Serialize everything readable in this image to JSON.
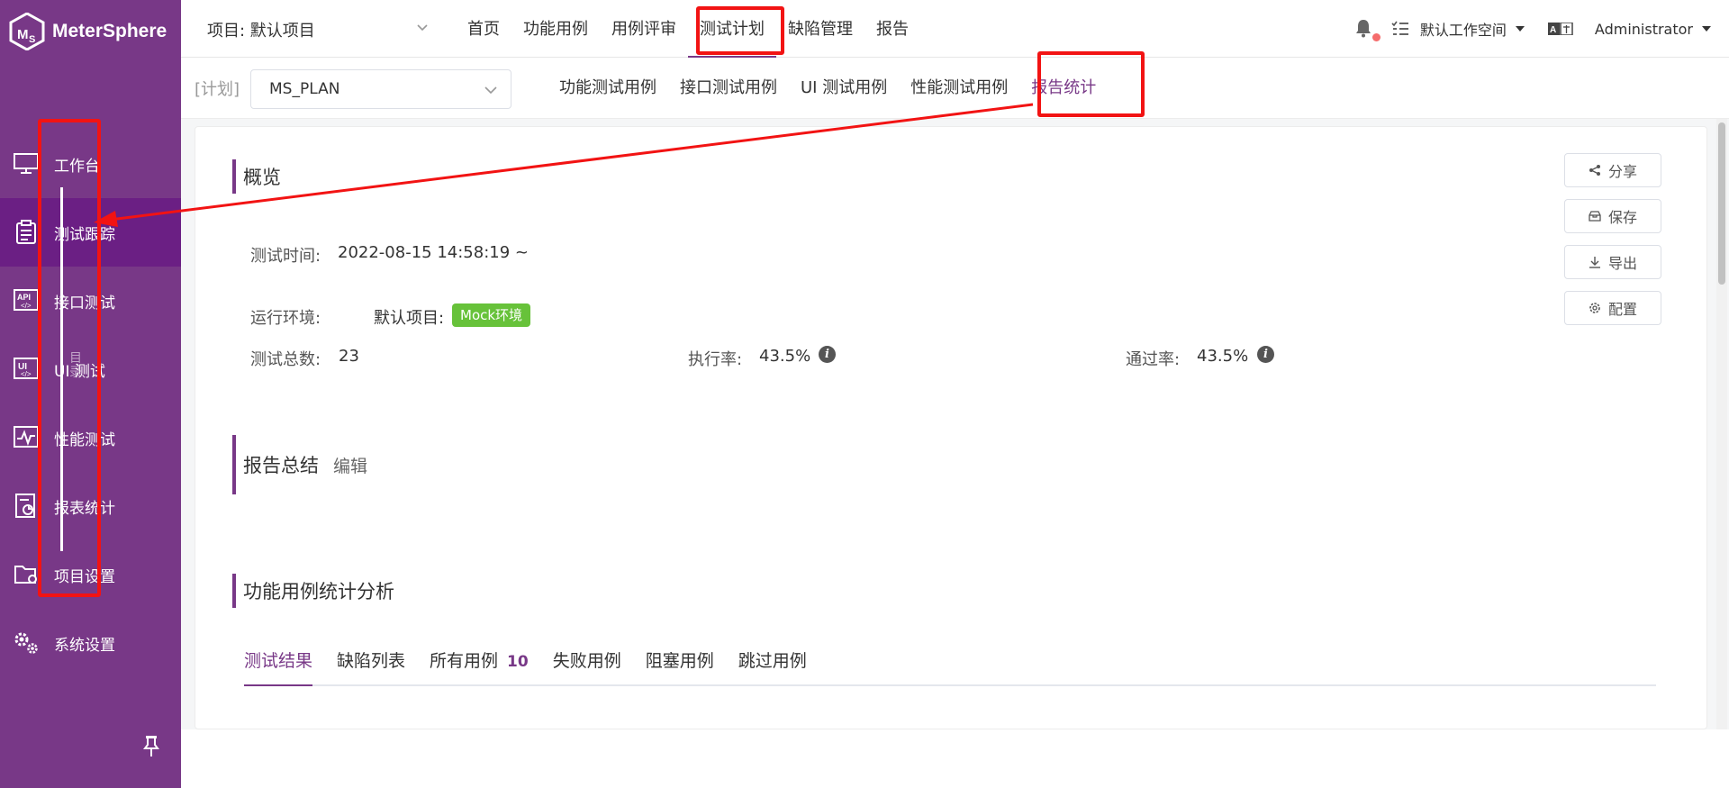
{
  "app": {
    "name": "MeterSphere"
  },
  "sidebar": {
    "items": [
      {
        "label": "工作台",
        "icon": "monitor-icon",
        "active": false
      },
      {
        "label": "测试跟踪",
        "icon": "clipboard-icon",
        "active": true
      },
      {
        "label": "接口测试",
        "icon": "api-icon",
        "active": false
      },
      {
        "label": "UI 测试",
        "icon": "ui-code-icon",
        "active": false
      },
      {
        "label": "性能测试",
        "icon": "performance-chart-icon",
        "active": false
      },
      {
        "label": "报表统计",
        "icon": "report-icon",
        "active": false
      },
      {
        "label": "项目设置",
        "icon": "folder-settings-icon",
        "active": false
      },
      {
        "label": "系统设置",
        "icon": "gears-icon",
        "active": false
      }
    ],
    "catalog_label": "目录",
    "pin_icon": "pin-icon"
  },
  "header": {
    "project_label": "项目: 默认项目",
    "nav": [
      {
        "label": "首页",
        "active": false
      },
      {
        "label": "功能用例",
        "active": false
      },
      {
        "label": "用例评审",
        "active": false
      },
      {
        "label": "测试计划",
        "active": true
      },
      {
        "label": "缺陷管理",
        "active": false
      },
      {
        "label": "报告",
        "active": false
      }
    ],
    "workspace": "默认工作空间",
    "user": "Administrator"
  },
  "subheader": {
    "plan_tag": "[计划]",
    "plan_value": "MS_PLAN",
    "tabs": [
      {
        "label": "功能测试用例",
        "active": false
      },
      {
        "label": "接口测试用例",
        "active": false
      },
      {
        "label": "UI 测试用例",
        "active": false
      },
      {
        "label": "性能测试用例",
        "active": false
      },
      {
        "label": "报告统计",
        "active": true
      }
    ]
  },
  "overview": {
    "title": "概览",
    "test_time_label": "测试时间:",
    "test_time_value": "2022-08-15 14:58:19 ~",
    "env_label": "运行环境:",
    "env_project": "默认项目:",
    "env_tag": "Mock环境",
    "total_label": "测试总数:",
    "total_value": "23",
    "exec_rate_label": "执行率:",
    "exec_rate_value": "43.5%",
    "pass_rate_label": "通过率:",
    "pass_rate_value": "43.5%"
  },
  "actions": {
    "share": "分享",
    "save": "保存",
    "export": "导出",
    "config": "配置"
  },
  "summary": {
    "title": "报告总结",
    "edit": "编辑"
  },
  "analysis": {
    "title": "功能用例统计分析",
    "tabs": [
      {
        "label": "测试结果",
        "active": true,
        "count": ""
      },
      {
        "label": "缺陷列表",
        "active": false,
        "count": ""
      },
      {
        "label": "所有用例",
        "active": false,
        "count": "10"
      },
      {
        "label": "失败用例",
        "active": false,
        "count": ""
      },
      {
        "label": "阻塞用例",
        "active": false,
        "count": ""
      },
      {
        "label": "跳过用例",
        "active": false,
        "count": ""
      }
    ]
  },
  "colors": {
    "brand": "#783887",
    "sidebar_active": "#6b1f84",
    "annotation": "#f21313",
    "env_tag": "#67c23a"
  }
}
